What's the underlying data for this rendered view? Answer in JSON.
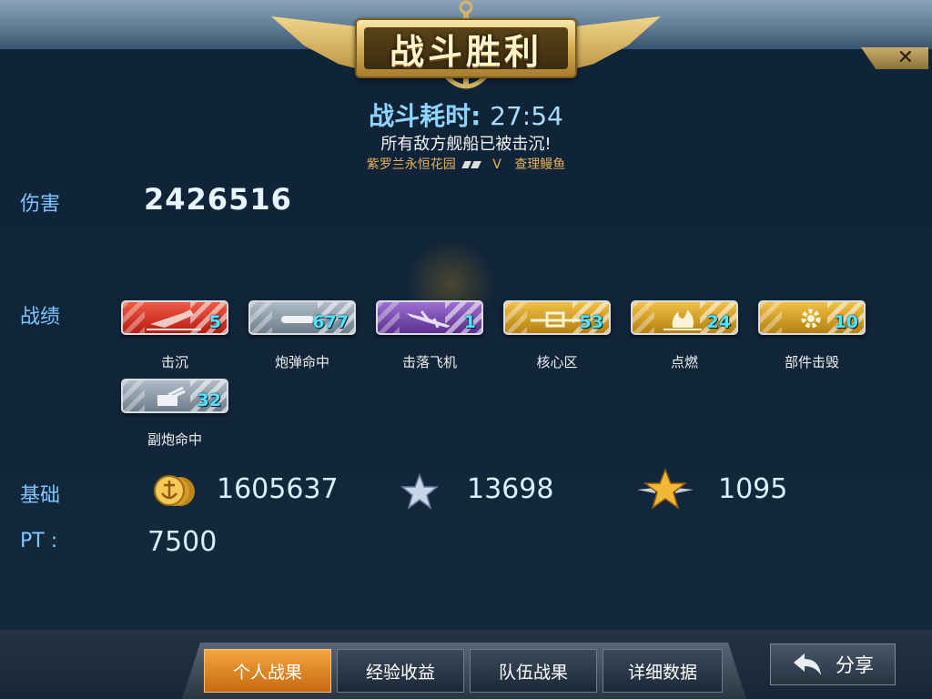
{
  "header": {
    "title": "战斗胜利",
    "time_label": "战斗耗时:",
    "time_value": "27:54",
    "subtitle": "所有敌方舰船已被击沉!",
    "team_left": "紫罗兰永恒花园",
    "vs": "V",
    "team_right": "查理鳗鱼"
  },
  "close_label": "✕",
  "damage": {
    "label": "伤害",
    "value": "2426516"
  },
  "records": {
    "label": "战绩",
    "items": [
      {
        "name": "击沉",
        "value": "5",
        "color": "#d8281c",
        "icon": "ship-sinking-icon"
      },
      {
        "name": "炮弹命中",
        "value": "677",
        "color": "#8a98a6",
        "icon": "shell-hit-icon"
      },
      {
        "name": "击落飞机",
        "value": "1",
        "color": "#7444a8",
        "icon": "plane-shot-icon"
      },
      {
        "name": "核心区",
        "value": "53",
        "color": "#d39a22",
        "icon": "citadel-icon"
      },
      {
        "name": "点燃",
        "value": "24",
        "color": "#d39a22",
        "icon": "fire-icon"
      },
      {
        "name": "部件击毁",
        "value": "10",
        "color": "#d39a22",
        "icon": "gear-icon"
      },
      {
        "name": "副炮命中",
        "value": "32",
        "color": "#8a98a6",
        "icon": "secondary-gun-icon"
      }
    ]
  },
  "base": {
    "label": "基础",
    "coins": "1605637",
    "exp": "13698",
    "captain_exp": "1095"
  },
  "pt": {
    "label": "PT :",
    "value": "7500"
  },
  "tabs": [
    {
      "label": "个人战果",
      "active": true
    },
    {
      "label": "经验收益",
      "active": false
    },
    {
      "label": "队伍战果",
      "active": false
    },
    {
      "label": "详细数据",
      "active": false
    }
  ],
  "share_label": "分享"
}
